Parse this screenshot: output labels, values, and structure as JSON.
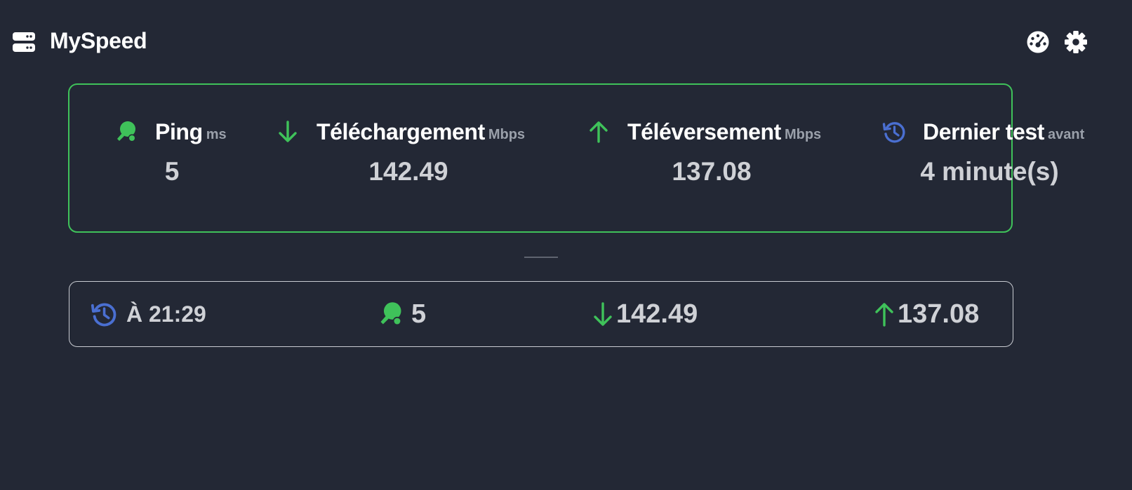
{
  "header": {
    "title": "MySpeed",
    "logo_icon": "server-icon",
    "actions": [
      {
        "name": "speedometer-icon",
        "tooltip": ""
      },
      {
        "name": "gear-icon",
        "tooltip": ""
      }
    ]
  },
  "colors": {
    "background": "#232835",
    "green": "#3fc25a",
    "blue": "#4a6fd1",
    "value_text": "#cfd1d6",
    "unit_text": "#9aa0aa"
  },
  "stats": {
    "ping": {
      "label": "Ping",
      "unit": "ms",
      "value": "5",
      "icon": "ping-pong-icon"
    },
    "download": {
      "label": "Téléchargement",
      "unit": "Mbps",
      "value": "142.49",
      "icon": "arrow-down-icon"
    },
    "upload": {
      "label": "Téléversement",
      "unit": "Mbps",
      "value": "137.08",
      "icon": "arrow-up-icon"
    },
    "last_test": {
      "label": "Dernier test",
      "unit": "avant",
      "value": "4 minute(s)",
      "icon": "history-icon"
    }
  },
  "history": [
    {
      "time": "À 21:29",
      "ping": "5",
      "download": "142.49",
      "upload": "137.08"
    }
  ]
}
